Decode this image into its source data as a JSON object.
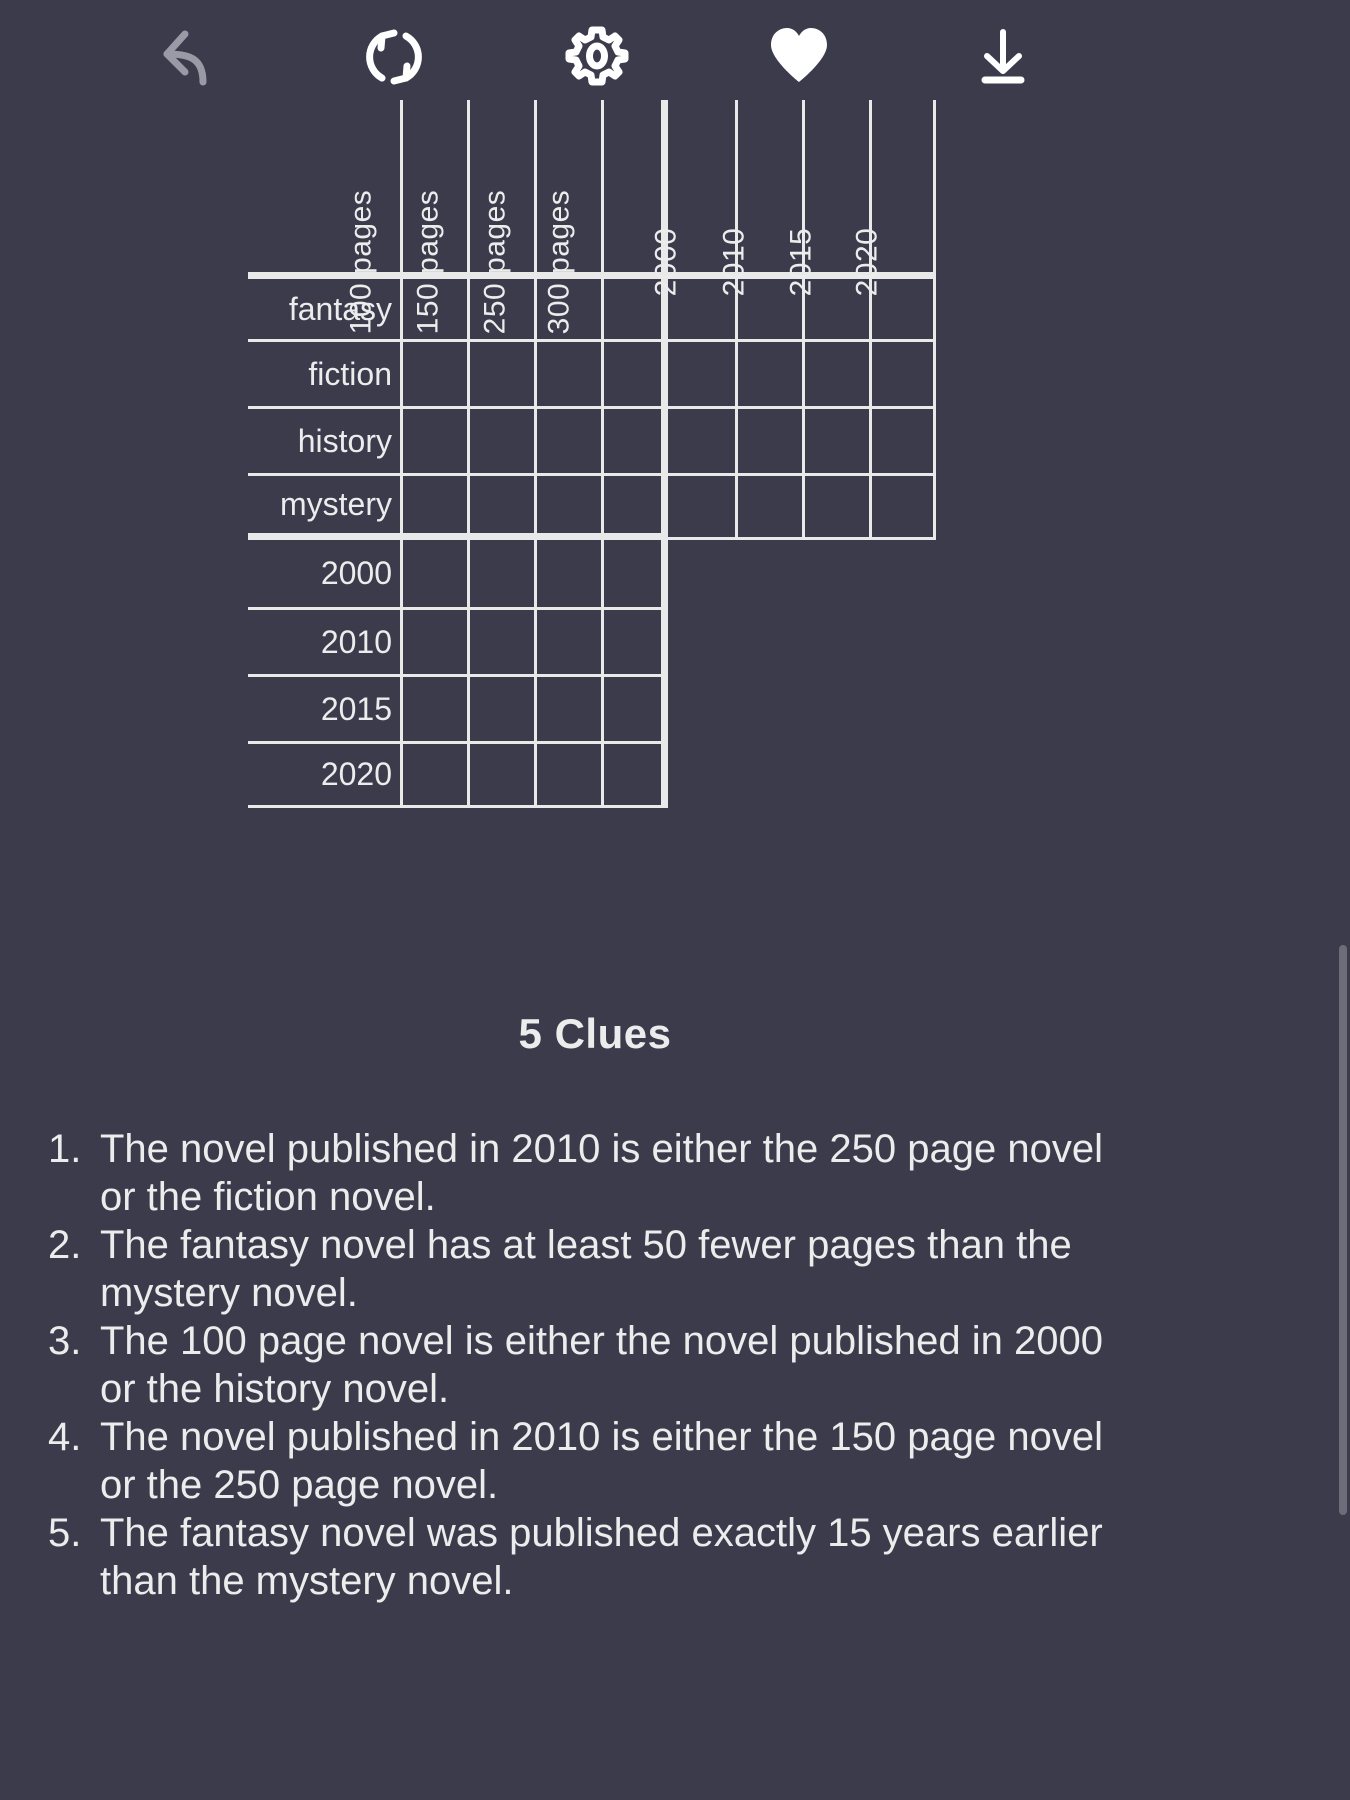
{
  "toolbar": {
    "items": [
      {
        "name": "undo-icon",
        "label": "Undo",
        "state": "disabled"
      },
      {
        "name": "restart-icon",
        "label": "Restart",
        "state": "enabled"
      },
      {
        "name": "settings-icon",
        "label": "Settings",
        "state": "enabled"
      },
      {
        "name": "favorite-icon",
        "label": "Favorite",
        "state": "enabled"
      },
      {
        "name": "download-icon",
        "label": "Download",
        "state": "enabled"
      }
    ]
  },
  "grid": {
    "column_groups": [
      {
        "name": "pages",
        "headers": [
          "100 pages",
          "150 pages",
          "250 pages",
          "300 pages"
        ]
      },
      {
        "name": "years",
        "headers": [
          "2000",
          "2010",
          "2015",
          "2020"
        ]
      }
    ],
    "row_groups": [
      {
        "name": "genres",
        "headers": [
          "fantasy",
          "fiction",
          "history",
          "mystery"
        ]
      },
      {
        "name": "years",
        "headers": [
          "2000",
          "2010",
          "2015",
          "2020"
        ]
      }
    ]
  },
  "clues": {
    "title": "5 Clues",
    "items": [
      {
        "num": "1.",
        "text": "The novel published in 2010 is either the 250 page novel or the fiction novel."
      },
      {
        "num": "2.",
        "text": "The fantasy novel has at least 50 fewer pages than the mystery novel."
      },
      {
        "num": "3.",
        "text": "The 100 page novel is either the novel published in 2000 or the history novel."
      },
      {
        "num": "4.",
        "text": "The novel published in 2010 is either the 150 page novel or the 250 page novel."
      },
      {
        "num": "5.",
        "text": "The fantasy novel was published exactly 15 years earlier than the mystery novel."
      }
    ]
  },
  "colors": {
    "background": "#3b3b4c",
    "line": "#e9e9e9",
    "text": "#ececec",
    "disabled_icon": "#9a9aa6",
    "scrollbar": "#6d6d79"
  }
}
